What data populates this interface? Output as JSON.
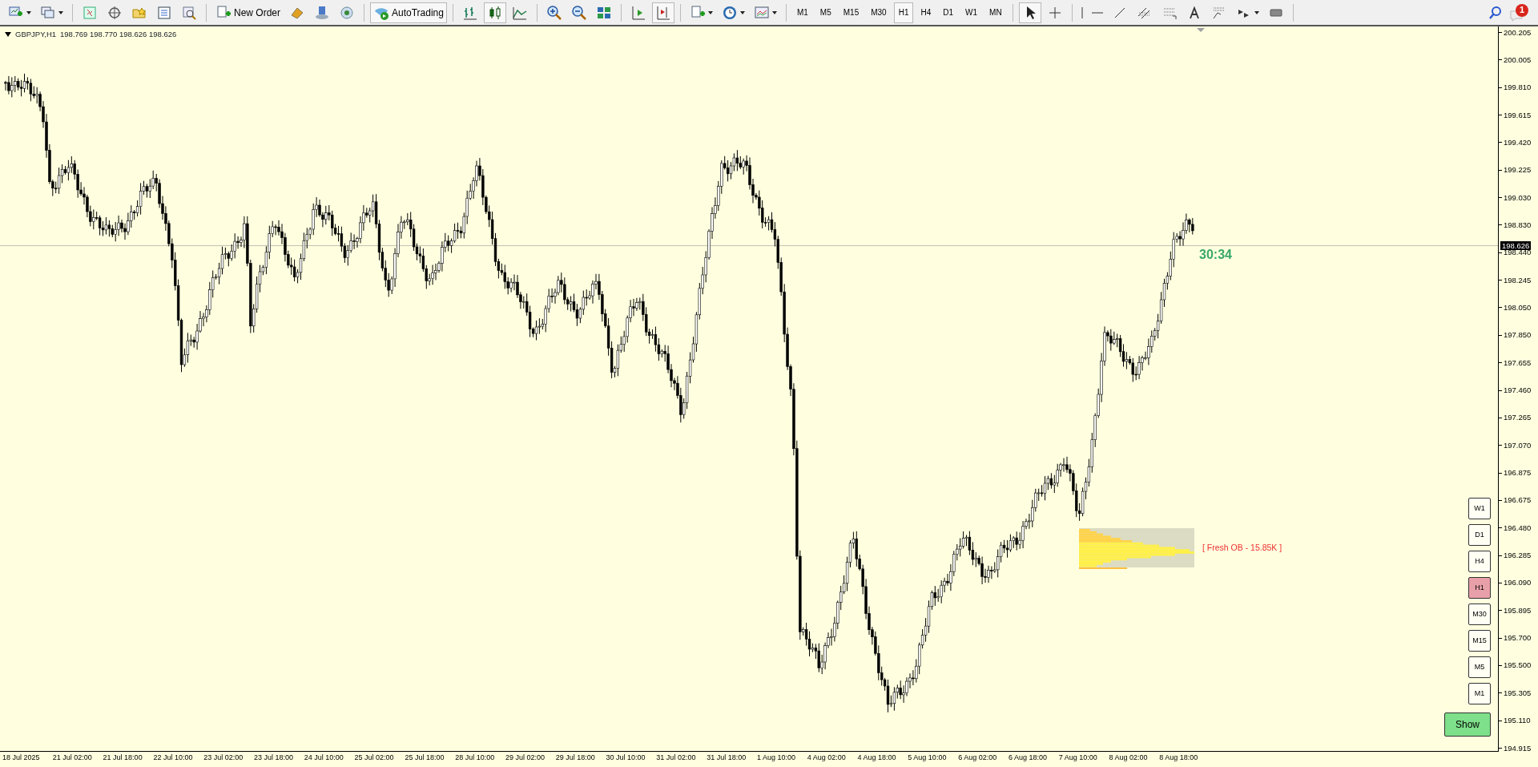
{
  "toolbar": {
    "new_order": "New Order",
    "autotrading": "AutoTrading",
    "timeframes": [
      {
        "label": "M1",
        "selected": false
      },
      {
        "label": "M5",
        "selected": false
      },
      {
        "label": "M15",
        "selected": false
      },
      {
        "label": "M30",
        "selected": false
      },
      {
        "label": "H1",
        "selected": true
      },
      {
        "label": "H4",
        "selected": false
      },
      {
        "label": "D1",
        "selected": false
      },
      {
        "label": "W1",
        "selected": false
      },
      {
        "label": "MN",
        "selected": false
      }
    ],
    "notifications": "1"
  },
  "chart": {
    "symbol": "GBPJPY,H1",
    "ohlc": "198.769 198.770 198.626 198.626",
    "price_labels": [
      "200.205",
      "200.005",
      "199.810",
      "199.615",
      "199.420",
      "199.225",
      "199.030",
      "198.830",
      "198.440",
      "198.245",
      "198.050",
      "197.850",
      "197.655",
      "197.460",
      "197.265",
      "197.070",
      "196.875",
      "196.675",
      "196.480",
      "196.285",
      "196.090",
      "195.895",
      "195.700",
      "195.500",
      "195.305",
      "195.110",
      "194.915"
    ],
    "current_price": "198.626",
    "time_labels": [
      "18 Jul 2025",
      "21 Jul 02:00",
      "21 Jul 18:00",
      "22 Jul 10:00",
      "23 Jul 02:00",
      "23 Jul 18:00",
      "24 Jul 10:00",
      "25 Jul 02:00",
      "25 Jul 18:00",
      "28 Jul 10:00",
      "29 Jul 02:00",
      "29 Jul 18:00",
      "30 Jul 10:00",
      "31 Jul 02:00",
      "31 Jul 18:00",
      "1 Aug 10:00",
      "4 Aug 02:00",
      "4 Aug 18:00",
      "5 Aug 10:00",
      "6 Aug 02:00",
      "6 Aug 18:00",
      "7 Aug 10:00",
      "8 Aug 02:00",
      "8 Aug 18:00"
    ],
    "countdown": "30:34",
    "zone_label": "[ Fresh OB - 15.85K ]",
    "timeframe_buttons": [
      {
        "label": "W1",
        "selected": false
      },
      {
        "label": "D1",
        "selected": false
      },
      {
        "label": "H4",
        "selected": false
      },
      {
        "label": "H1",
        "selected": true
      },
      {
        "label": "M30",
        "selected": false
      },
      {
        "label": "M15",
        "selected": false
      },
      {
        "label": "M5",
        "selected": false
      },
      {
        "label": "M1",
        "selected": false
      }
    ],
    "show_button": "Show"
  }
}
